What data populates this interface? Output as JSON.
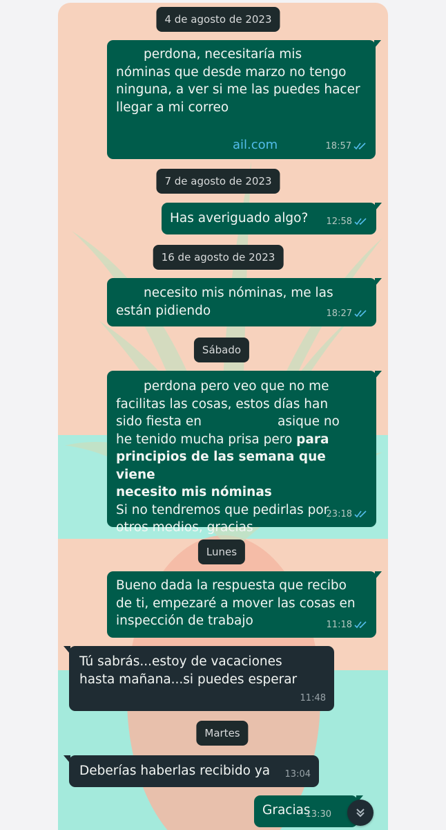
{
  "colors": {
    "outgoing_bubble": "#005c4b",
    "incoming_bubble": "#1f2c33",
    "date_chip": "#1e2a2c",
    "read_ticks": "#53bdeb"
  },
  "dates": {
    "d1": "4 de agosto de 2023",
    "d2": "7 de agosto de 2023",
    "d3": "16 de agosto de 2023",
    "d4": "Sábado",
    "d5": "Lunes",
    "d6": "Martes"
  },
  "messages": [
    {
      "direction": "out",
      "lines": [
        "perdona, necesitaría mis",
        "nóminas que desde marzo no tengo",
        "ninguna, a ver si me las puedes hacer",
        "llegar a mi correo"
      ],
      "link": "ail.com",
      "time": "18:57",
      "status": "read"
    },
    {
      "direction": "out",
      "lines": [
        "Has averiguado algo?"
      ],
      "time": "12:58",
      "status": "read"
    },
    {
      "direction": "out",
      "lines": [
        "necesito mis nóminas, me las",
        "están pidiendo"
      ],
      "time": "18:27",
      "status": "read"
    },
    {
      "direction": "out",
      "lines": [
        "perdona pero veo que no me",
        "facilitas las cosas, estos días han",
        "sido fiesta en",
        "asique no",
        "he tenido mucha prisa pero",
        "para",
        "principios de las semana que viene",
        "necesito mis nóminas",
        "Si no tendremos que pedirlas por",
        "otros medios, gracias"
      ],
      "time": "23:18",
      "status": "read"
    },
    {
      "direction": "out",
      "lines": [
        "Bueno dada la respuesta que recibo",
        "de ti, empezaré a mover las cosas en",
        "inspección de trabajo"
      ],
      "time": "11:18",
      "status": "read"
    },
    {
      "direction": "in",
      "lines": [
        "Tú sabrás...estoy de vacaciones",
        "hasta mañana...si puedes esperar"
      ],
      "time": "11:48"
    },
    {
      "direction": "in",
      "lines": [
        "Deberías haberlas recibido ya"
      ],
      "time": "13:04"
    },
    {
      "direction": "out",
      "lines": [
        "Gracias"
      ],
      "time": "13:30"
    }
  ],
  "icons": {
    "read": "double-check-icon",
    "scroll": "chevron-double-down-icon"
  }
}
